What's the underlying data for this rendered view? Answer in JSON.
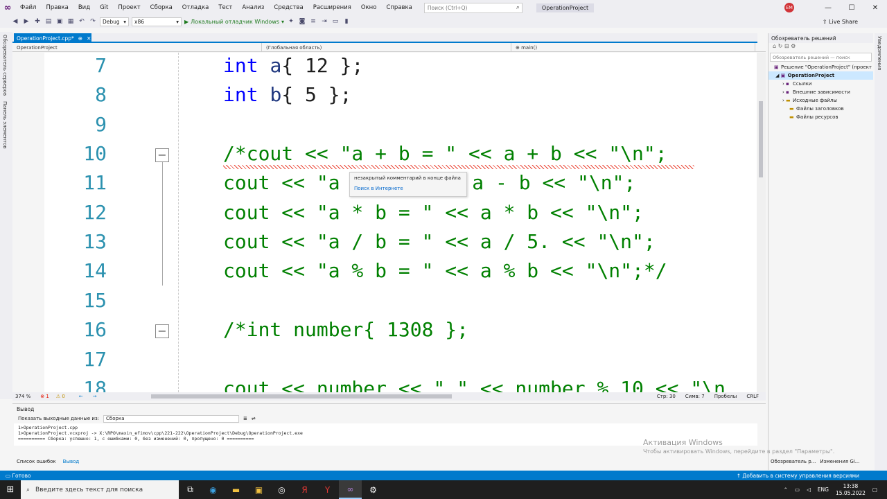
{
  "menu": [
    "Файл",
    "Правка",
    "Вид",
    "Git",
    "Проект",
    "Сборка",
    "Отладка",
    "Тест",
    "Анализ",
    "Средства",
    "Расширения",
    "Окно",
    "Справка"
  ],
  "search_placeholder": "Поиск (Ctrl+Q)",
  "project_name": "OperationProject",
  "user_initials": "EM",
  "toolbar": {
    "config": "Debug",
    "platform": "x86",
    "run_label": "Локальный отладчик Windows",
    "live_share": "Live Share"
  },
  "left_strip": [
    "Обозреватель серверов",
    "Панель элементов"
  ],
  "doc_tab": {
    "label": "OperationProject.cpp*"
  },
  "nav_bar": {
    "project": "OperationProject",
    "scope": "(Глобальная область)",
    "function": "main()"
  },
  "editor": {
    "line_numbers": [
      "7",
      "8",
      "9",
      "10",
      "11",
      "12",
      "13",
      "14",
      "15",
      "16",
      "17",
      "18"
    ],
    "lines": {
      "l7": {
        "kw": "int",
        "var": "a",
        "rest": "{ 12 };"
      },
      "l8": {
        "kw": "int",
        "var": "b",
        "rest": "{ 5 };"
      },
      "l10": "/*cout << \"a + b = \" << a + b << \"\\n\";",
      "l11a": "cout << \"a",
      "l11b": "< a - b << \"\\n\";",
      "l12": "cout << \"a * b = \" << a * b << \"\\n\";",
      "l13": "cout << \"a / b = \" << a / 5. << \"\\n\";",
      "l14": "cout << \"a % b = \" << a % b << \"\\n\";*/",
      "l16": "/*int number{ 1308 };",
      "l18": "cout << number << \" \" << number % 10 << \"\\n"
    },
    "tooltip": {
      "message": "незакрытый комментарий в конце файла",
      "link": "Поиск в Интернете"
    }
  },
  "editor_status": {
    "zoom": "374 %",
    "errors": "1",
    "warnings": "0",
    "position": "Стр: 30",
    "column": "Симв: 7",
    "spaces": "Пробелы",
    "line_ending": "CRLF"
  },
  "solution_explorer": {
    "title": "Обозреватель решений",
    "search": "Обозреватель решений — поиск",
    "items": [
      {
        "label": "Решение \"OperationProject\" (проект",
        "indent": 0
      },
      {
        "label": "OperationProject",
        "indent": 1,
        "selected": true
      },
      {
        "label": "Ссылки",
        "indent": 2
      },
      {
        "label": "Внешние зависимости",
        "indent": 2
      },
      {
        "label": "Исходные файлы",
        "indent": 2
      },
      {
        "label": "Файлы заголовков",
        "indent": 2
      },
      {
        "label": "Файлы ресурсов",
        "indent": 2
      }
    ],
    "bottom_tabs": [
      "Обозреватель р...",
      "Изменения Gi..."
    ]
  },
  "right_strip": "Уведомления",
  "output": {
    "title": "Вывод",
    "show_from_label": "Показать выходные данные из:",
    "source": "Сборка",
    "lines": [
      "1>OperationProject.cpp",
      "1>OperationProject.vcxproj -> X:\\RPO\\maxin_efimov\\cpp\\221-222\\OperationProject\\Debug\\OperationProject.exe",
      "========== Сборка: успешно: 1, с ошибками: 0, без изменений: 0, пропущено: 0 =========="
    ]
  },
  "activation": {
    "title": "Активация Windows",
    "subtitle": "Чтобы активировать Windows, перейдите в раздел \"Параметры\"."
  },
  "bottom_tabs": [
    "Список ошибок",
    "Вывод"
  ],
  "statusbar": {
    "ready": "Готово",
    "source_control": "Добавить в систему управления версиями"
  },
  "taskbar": {
    "search": "Введите здесь текст для поиска",
    "lang": "ENG",
    "time": "13:38",
    "date": "15.05.2022"
  }
}
